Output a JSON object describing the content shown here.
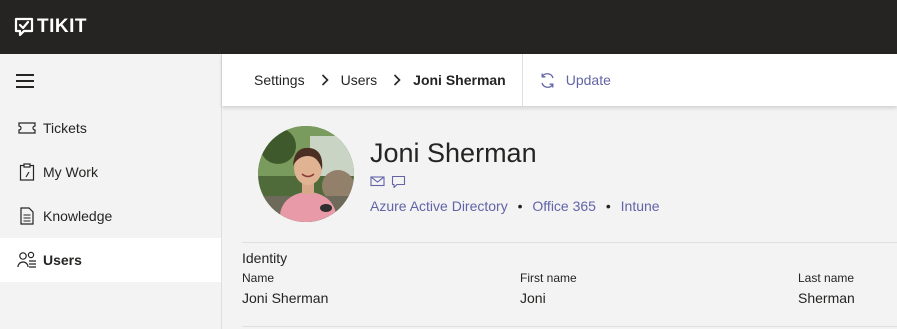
{
  "app": {
    "logo_text": "TIKIT"
  },
  "sidebar": {
    "items": [
      {
        "label": "Tickets",
        "icon": "ticket-icon",
        "active": false
      },
      {
        "label": "My Work",
        "icon": "clipboard-icon",
        "active": false
      },
      {
        "label": "Knowledge",
        "icon": "document-icon",
        "active": false
      },
      {
        "label": "Users",
        "icon": "users-icon",
        "active": true
      }
    ]
  },
  "breadcrumb": {
    "items": [
      "Settings",
      "Users",
      "Joni Sherman"
    ]
  },
  "toolbar": {
    "update_label": "Update"
  },
  "profile": {
    "name": "Joni Sherman",
    "sources": [
      "Azure Active Directory",
      "Office 365",
      "Intune"
    ],
    "separator": "•"
  },
  "identity": {
    "title": "Identity",
    "fields": [
      {
        "label": "Name",
        "value": "Joni Sherman"
      },
      {
        "label": "First name",
        "value": "Joni"
      },
      {
        "label": "Last name",
        "value": "Sherman"
      }
    ]
  },
  "colors": {
    "accent": "#6264a7",
    "topbar": "#252423"
  }
}
